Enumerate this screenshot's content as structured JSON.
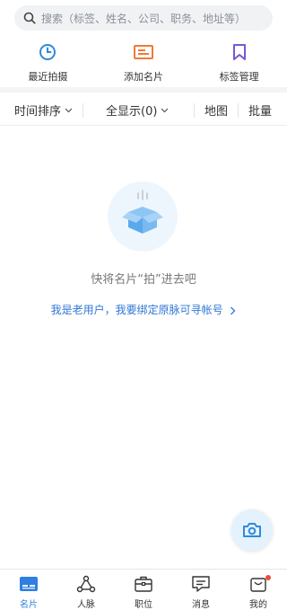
{
  "search": {
    "placeholder": "搜索（标签、姓名、公司、职务、地址等）",
    "icon": "search-icon"
  },
  "quick_actions": [
    {
      "label": "最近拍摄",
      "icon": "clock-icon",
      "color": "#2f8ad8"
    },
    {
      "label": "添加名片",
      "icon": "card-icon",
      "color": "#ef7a38"
    },
    {
      "label": "标签管理",
      "icon": "bookmark-icon",
      "color": "#7a56d6"
    }
  ],
  "filters": {
    "sort_label": "时间排序",
    "display_label": "全显示(0)",
    "map_label": "地图",
    "batch_label": "批量"
  },
  "empty_state": {
    "icon": "empty-box-icon",
    "message": "快将名片“拍”进去吧",
    "bind_link": "我是老用户，我要绑定原脉可寻帐号"
  },
  "fab": {
    "icon": "camera-icon",
    "color": "#2f8ad8"
  },
  "tabbar": {
    "items": [
      {
        "label": "名片",
        "icon": "card-tab-icon",
        "active": true
      },
      {
        "label": "人脉",
        "icon": "network-icon",
        "active": false
      },
      {
        "label": "职位",
        "icon": "briefcase-icon",
        "active": false
      },
      {
        "label": "消息",
        "icon": "message-icon",
        "active": false
      },
      {
        "label": "我的",
        "icon": "profile-icon",
        "active": false,
        "badge": true
      }
    ],
    "active_color": "#2f7fe0",
    "badge_color": "#f04a3e"
  }
}
